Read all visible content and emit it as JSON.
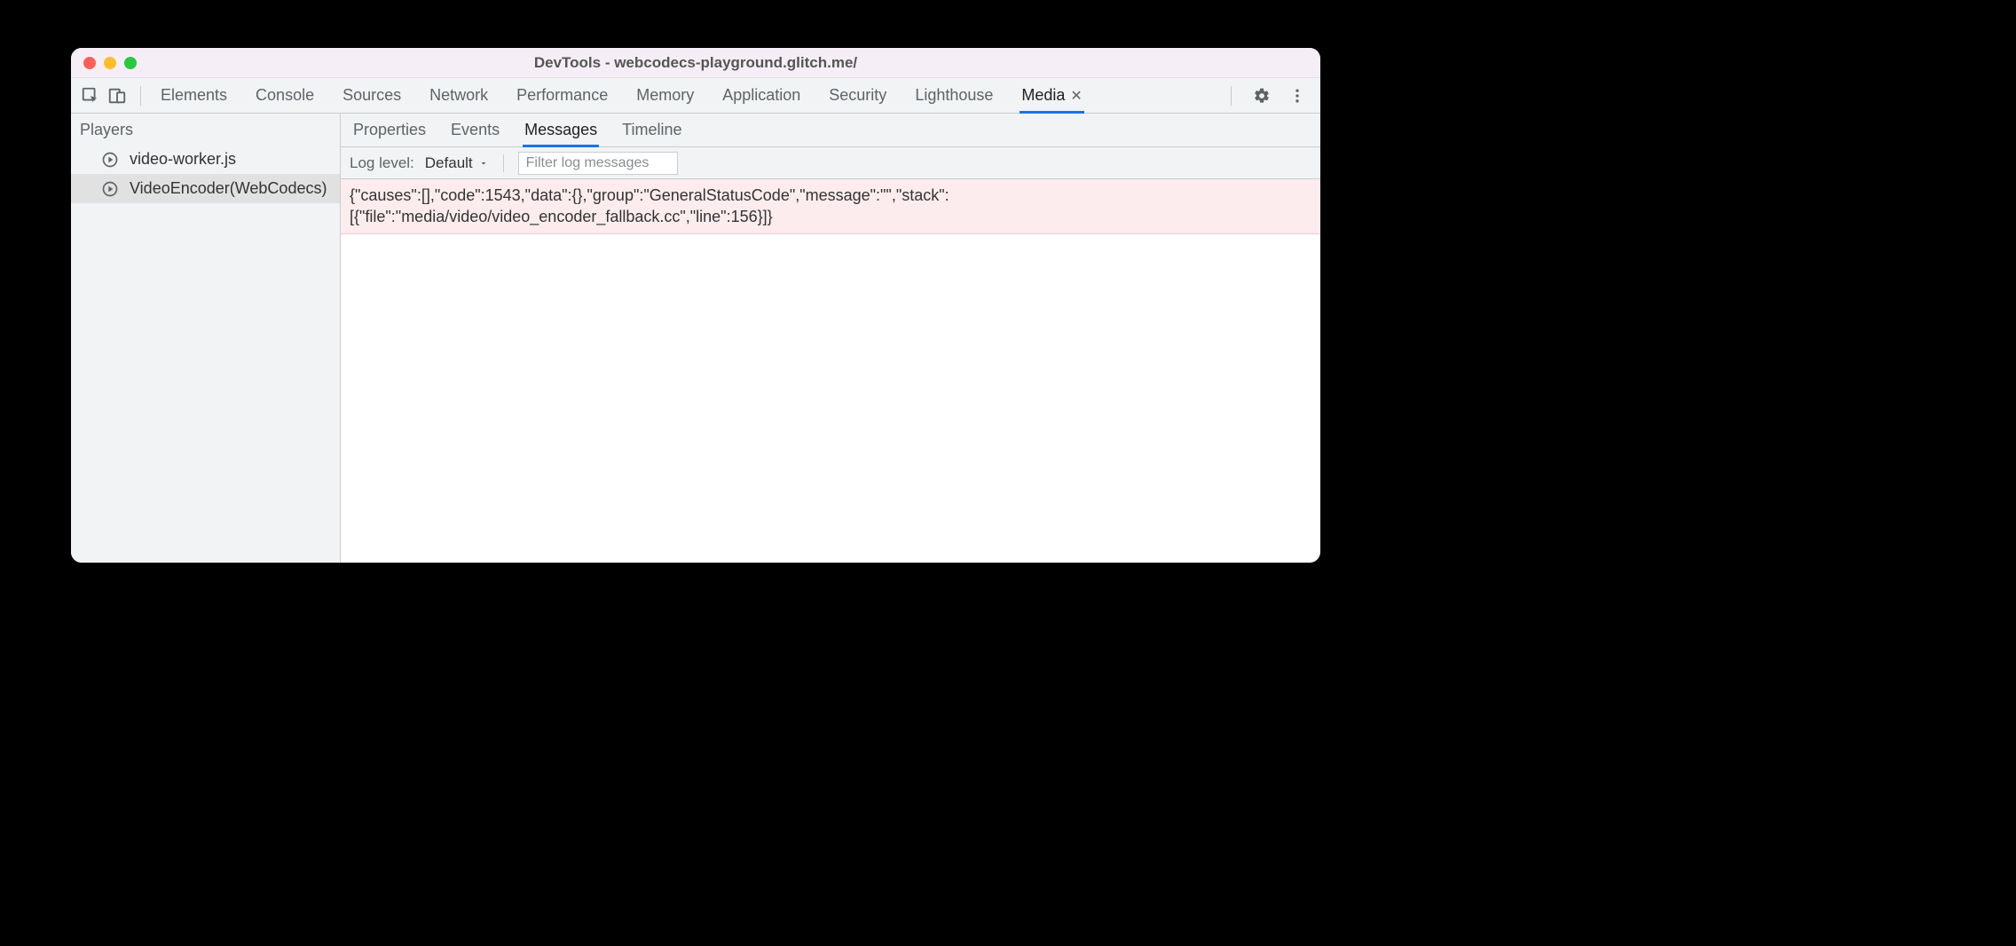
{
  "window": {
    "title": "DevTools - webcodecs-playground.glitch.me/"
  },
  "main_tabs": [
    {
      "label": "Elements",
      "active": false,
      "closable": false
    },
    {
      "label": "Console",
      "active": false,
      "closable": false
    },
    {
      "label": "Sources",
      "active": false,
      "closable": false
    },
    {
      "label": "Network",
      "active": false,
      "closable": false
    },
    {
      "label": "Performance",
      "active": false,
      "closable": false
    },
    {
      "label": "Memory",
      "active": false,
      "closable": false
    },
    {
      "label": "Application",
      "active": false,
      "closable": false
    },
    {
      "label": "Security",
      "active": false,
      "closable": false
    },
    {
      "label": "Lighthouse",
      "active": false,
      "closable": false
    },
    {
      "label": "Media",
      "active": true,
      "closable": true
    }
  ],
  "sidebar": {
    "title": "Players",
    "items": [
      {
        "label": "video-worker.js",
        "selected": false
      },
      {
        "label": "VideoEncoder(WebCodecs)",
        "selected": true
      }
    ]
  },
  "sub_tabs": [
    {
      "label": "Properties",
      "active": false
    },
    {
      "label": "Events",
      "active": false
    },
    {
      "label": "Messages",
      "active": true
    },
    {
      "label": "Timeline",
      "active": false
    }
  ],
  "toolbar": {
    "loglevel_label": "Log level:",
    "loglevel_value": "Default",
    "filter_placeholder": "Filter log messages"
  },
  "messages": [
    {
      "text": "{\"causes\":[],\"code\":1543,\"data\":{},\"group\":\"GeneralStatusCode\",\"message\":\"\",\"stack\":[{\"file\":\"media/video/video_encoder_fallback.cc\",\"line\":156}]}"
    }
  ]
}
